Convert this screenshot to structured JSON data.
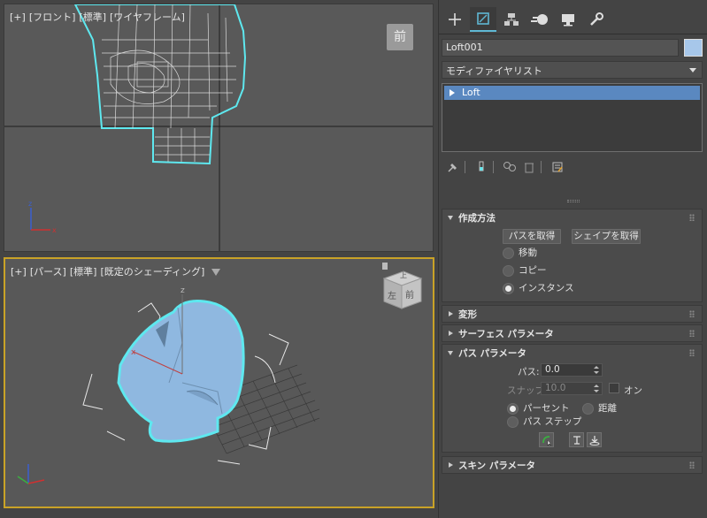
{
  "viewport_front": {
    "label_plus": "[+]",
    "label_view": "[フロント]",
    "label_std": "[標準]",
    "label_shading": "[ワイヤフレーム]",
    "viewcube": "前"
  },
  "viewport_persp": {
    "label_plus": "[+]",
    "label_view": "[パース]",
    "label_std": "[標準]",
    "label_shading": "[既定のシェーディング]",
    "viewcube_top": "上",
    "viewcube_left": "左",
    "viewcube_front": "前"
  },
  "command_panel": {
    "tabs": [
      "create-icon",
      "modify-icon",
      "hierarchy-icon",
      "motion-icon",
      "display-icon",
      "utilities-icon"
    ],
    "object_name": "Loft001",
    "object_color": "#a7c7ea",
    "modifier_list": "モディファイヤリスト",
    "stack": [
      "Loft"
    ]
  },
  "rollouts": {
    "creation_method": {
      "title": "作成方法",
      "get_path": "パスを取得",
      "get_shape": "シェイプを取得",
      "move": "移動",
      "copy": "コピー",
      "instance": "インスタンス",
      "selected": "instance"
    },
    "deformations": {
      "title": "変形"
    },
    "surface_params": {
      "title": "サーフェス パラメータ"
    },
    "path_params": {
      "title": "パス パラメータ",
      "path_label": "パス:",
      "path_value": "0.0",
      "snap_label": "スナップ:",
      "snap_value": "10.0",
      "snap_on": "オン",
      "percentage": "パーセント",
      "distance": "距離",
      "path_steps": "パス ステップ",
      "selected": "percentage"
    },
    "skin_params": {
      "title": "スキン パラメータ"
    }
  },
  "colors": {
    "viewport_bg": "#595959",
    "active_border": "#c9a227",
    "wire_selected": "#5ee8ef",
    "object_fill": "#8fb8e0",
    "stack_highlight": "#5a88c0"
  }
}
